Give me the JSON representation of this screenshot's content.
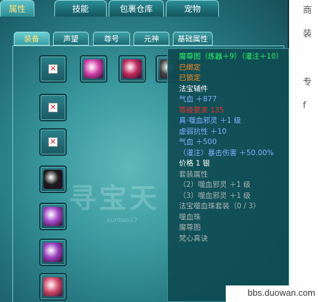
{
  "top_tabs": [
    {
      "label": "属性"
    },
    {
      "label": "技能"
    },
    {
      "label": "包裹仓库"
    },
    {
      "label": "宠物"
    }
  ],
  "sub_tabs": [
    {
      "label": "装备"
    },
    {
      "label": "声望"
    },
    {
      "label": "尊号"
    },
    {
      "label": "元神"
    },
    {
      "label": "基础属性"
    }
  ],
  "side_text": [
    "商",
    "装",
    "专",
    "f"
  ],
  "watermark": {
    "text": "寻宝天",
    "small": "xunbao17"
  },
  "slots": [
    {
      "kind": "empty",
      "mark": "✕"
    },
    {
      "kind": "item",
      "icon": "pink-orb-icon",
      "color": "#d23fa8"
    },
    {
      "kind": "item",
      "icon": "demon-mask-icon",
      "color": "#c2285a"
    },
    {
      "kind": "item",
      "icon": "dark-relic-icon",
      "color": "#444"
    },
    {
      "kind": "empty",
      "mark": "✕"
    },
    {
      "kind": "empty",
      "mark": "✕"
    },
    {
      "kind": "item",
      "icon": "amulet-icon",
      "color": "#1a1a1a"
    },
    {
      "kind": "item",
      "icon": "purple-bracer-icon",
      "color": "#a447c8"
    },
    {
      "kind": "item",
      "icon": "purple-bracer-icon",
      "color": "#9c3fbf"
    },
    {
      "kind": "item",
      "icon": "red-gem-icon",
      "color": "#d44a6a"
    }
  ],
  "tooltip": {
    "lines": [
      {
        "text": "魔尊图（炼器＋9）（灌注＋10）",
        "color": "#2cf26a"
      },
      {
        "text": "已绑定",
        "color": "#ff8a1a"
      },
      {
        "text": "已锁定",
        "color": "#ff8a1a"
      },
      {
        "text": "法宝辅件",
        "color": "#ffffff"
      },
      {
        "text": "气血 ＋877",
        "color": "#7fb0ff"
      },
      {
        "text": "等级要求 135",
        "color": "#e83030"
      },
      {
        "text": "真·噬血邪灵 ＋1 级",
        "color": "#7fb0ff"
      },
      {
        "text": "虚弱抗性 ＋10",
        "color": "#7fb0ff"
      },
      {
        "text": "气血 ＋500",
        "color": "#7fb0ff"
      },
      {
        "text": "（灌注）暴击伤害 ＋50.00%",
        "color": "#7fb0ff"
      },
      {
        "text": "价格 1 银",
        "color": "#ffffff"
      },
      {
        "text": "套装属性",
        "color": "#a8b4b6"
      },
      {
        "text": "（2）噬血邪灵 ＋1 级",
        "color": "#a8b4b6"
      },
      {
        "text": "（3）噬血邪灵 ＋1 级",
        "color": "#a8b4b6"
      },
      {
        "text": "法宝噬血珠套装（0 / 3）",
        "color": "#a8b4b6"
      },
      {
        "text": "噬血珠",
        "color": "#a8b4b6"
      },
      {
        "text": "魔尊图",
        "color": "#a8b4b6"
      },
      {
        "text": "梵心真诀",
        "color": "#a8b4b6"
      }
    ]
  },
  "site_watermark": "bbs.duowan.com"
}
